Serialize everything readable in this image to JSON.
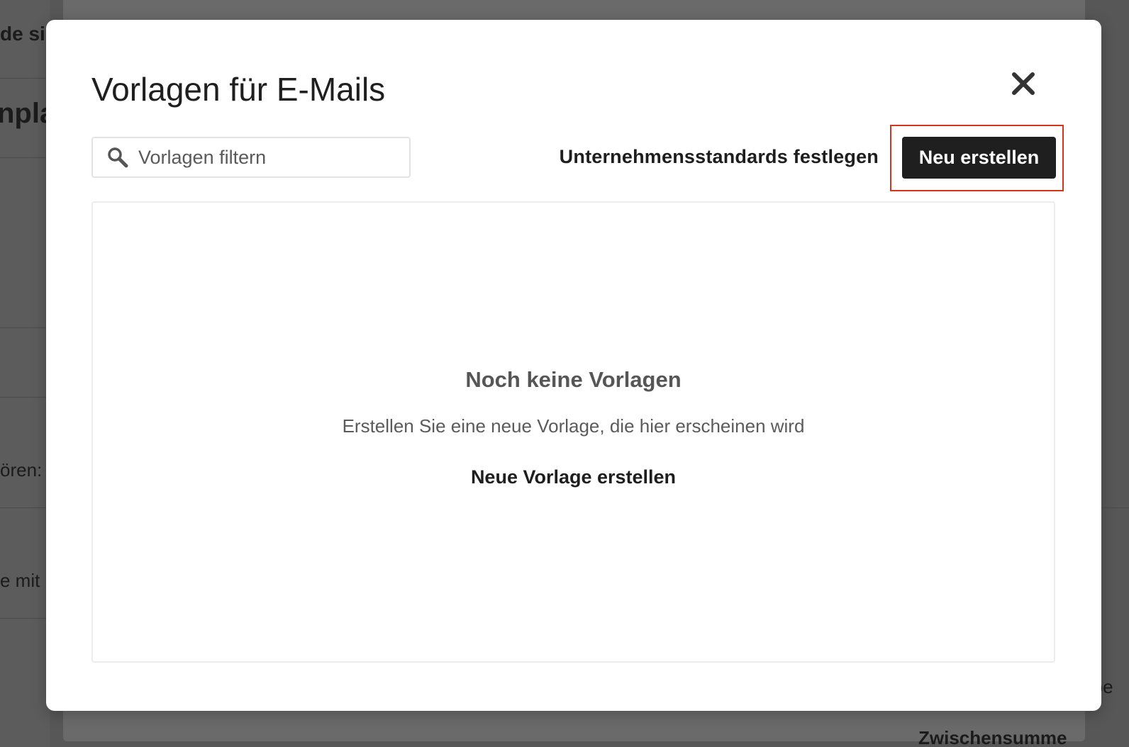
{
  "background": {
    "fragments": [
      "de si",
      "npla",
      "ören:",
      "e mit",
      "rbe",
      "Zwischensumme"
    ]
  },
  "modal": {
    "title": "Vorlagen für E-Mails",
    "close_icon": "close-icon",
    "search": {
      "placeholder": "Vorlagen filtern",
      "value": "",
      "icon": "search-icon"
    },
    "company_defaults_label": "Unternehmensstandards festlegen",
    "new_button_label": "Neu erstellen",
    "highlight_color": "#d2361c",
    "empty_state": {
      "title": "Noch keine Vorlagen",
      "description": "Erstellen Sie eine neue Vorlage, die hier erscheinen wird",
      "create_link": "Neue Vorlage erstellen"
    }
  }
}
